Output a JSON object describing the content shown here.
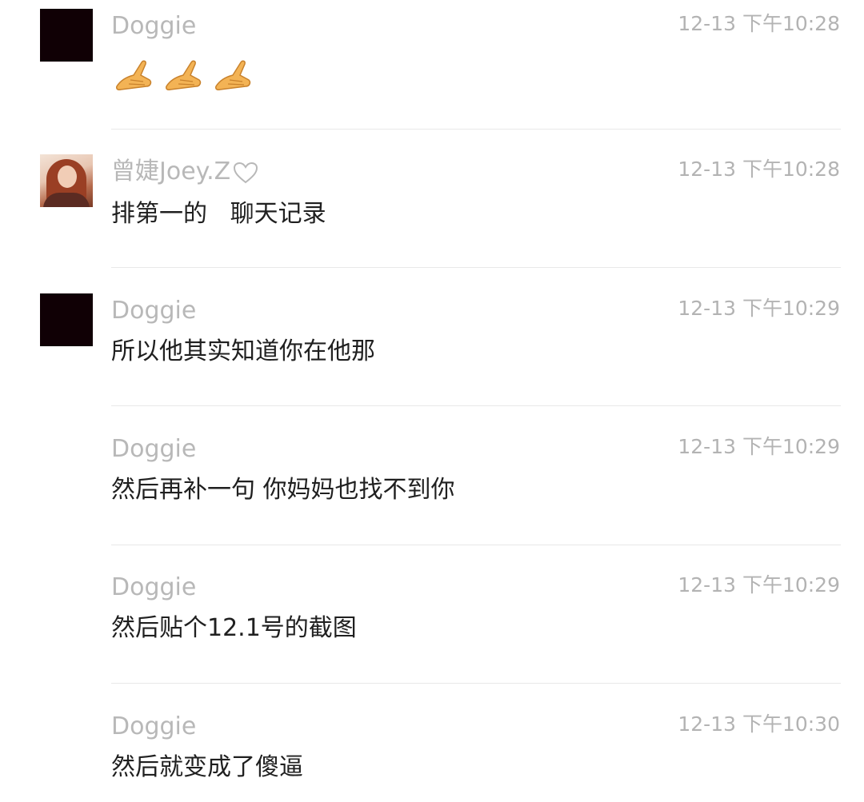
{
  "messages": [
    {
      "sender": "Doggie",
      "time": "12-13 下午10:28",
      "avatar": "dark-square",
      "content_type": "emoji",
      "emoji_icons": [
        "pinching-hand-icon",
        "pinching-hand-icon",
        "pinching-hand-icon"
      ]
    },
    {
      "sender": "曾婕Joey.Z",
      "sender_badge_icon": "heart-outline-icon",
      "time": "12-13 下午10:28",
      "avatar": "profile-photo",
      "text": "排第一的   聊天记录"
    },
    {
      "sender": "Doggie",
      "time": "12-13 下午10:29",
      "avatar": "dark-square",
      "text": "所以他其实知道你在他那"
    },
    {
      "sender": "Doggie",
      "time": "12-13 下午10:29",
      "text": "然后再补一句 你妈妈也找不到你"
    },
    {
      "sender": "Doggie",
      "time": "12-13 下午10:29",
      "text": "然后贴个12.1号的截图"
    },
    {
      "sender": "Doggie",
      "time": "12-13 下午10:30",
      "text": "然后就变成了傻逼"
    }
  ],
  "colors": {
    "background": "#ffffff",
    "sender_name": "#b8b8b8",
    "timestamp": "#b3b3b3",
    "message_text": "#202020",
    "divider": "#e8e8e8",
    "dark_avatar": "#100005",
    "emoji_skin": "#f3b355"
  }
}
